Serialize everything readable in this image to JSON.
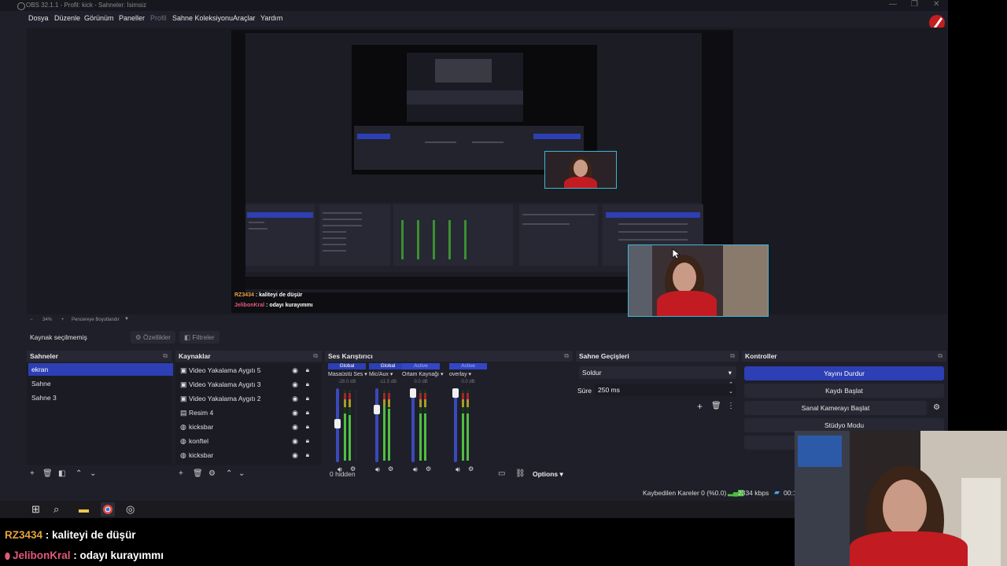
{
  "window": {
    "title": "OBS 32.1.1 - Profil: kick - Sahneler: İsimsiz",
    "controls": [
      "—",
      "❐",
      "✕"
    ]
  },
  "menu": [
    {
      "label": "Dosya",
      "enabled": true
    },
    {
      "label": "Düzenle",
      "enabled": true
    },
    {
      "label": "Görünüm",
      "enabled": true
    },
    {
      "label": "Paneller",
      "enabled": true
    },
    {
      "label": "Profil",
      "enabled": false
    },
    {
      "label": "Sahne Koleksiyonu",
      "enabled": true
    },
    {
      "label": "Araçlar",
      "enabled": true
    },
    {
      "label": "Yardım",
      "enabled": true
    }
  ],
  "preview": {
    "nested_chat": [
      {
        "name": "RZ3434",
        "message": " : kaliteyi de düşür"
      },
      {
        "name": "JelibonKral",
        "message": " : odayı kurayımmı"
      }
    ]
  },
  "zoom": {
    "value": "34%",
    "action": "Pencereye Boyutlandır"
  },
  "source_bar": {
    "status": "Kaynak seçilmemiş",
    "properties": "Özellikler",
    "filters": "Filtreler"
  },
  "scenes": {
    "title": "Sahneler",
    "items": [
      "ekran",
      "Sahne",
      "Sahne 3"
    ],
    "selected_index": 0
  },
  "sources": {
    "title": "Kaynaklar",
    "items": [
      {
        "label": "Video Yakalama Aygıtı 5",
        "icon": "camera-icon"
      },
      {
        "label": "Video Yakalama Aygıtı 3",
        "icon": "camera-icon"
      },
      {
        "label": "Video Yakalama Aygıtı 2",
        "icon": "camera-icon"
      },
      {
        "label": "Resim 4",
        "icon": "image-icon"
      },
      {
        "label": "kicksbar",
        "icon": "globe-icon"
      },
      {
        "label": "konftel",
        "icon": "globe-icon"
      },
      {
        "label": "kicksbar",
        "icon": "globe-icon"
      }
    ]
  },
  "mixer": {
    "title": "Ses Karıştırıcı",
    "channels": [
      {
        "tag": "Global",
        "tag_color": "#2d3fb4",
        "name": "Masaüstü Ses",
        "db": "-28.0 dB",
        "fader_level": 0.52
      },
      {
        "tag": "Global",
        "tag_color": "#2d3fb4",
        "name": "Mic/Aux",
        "db": "-11.5 dB",
        "fader_level": 0.75
      },
      {
        "tag": "Active",
        "tag_color": "#5a6ee0",
        "name": "Ortam Kaynağı",
        "db": "0.0 dB",
        "fader_level": 1.0
      },
      {
        "tag": "Active",
        "tag_color": "#5a6ee0",
        "name": "overlay",
        "db": "0.0 dB",
        "fader_level": 1.0
      }
    ],
    "hidden": "0 hidden",
    "options": "Options"
  },
  "transitions": {
    "title": "Sahne Geçişleri",
    "selected": "Soldur",
    "duration_label": "Süre",
    "duration_value": "250 ms"
  },
  "controls": {
    "title": "Kontroller",
    "buttons": [
      {
        "label": "Yayını Durdur",
        "primary": true
      },
      {
        "label": "Kaydı Başlat",
        "primary": false
      },
      {
        "label": "Sanal Kamerayı Başlat",
        "primary": false
      },
      {
        "label": "Stüdyo Modu",
        "primary": false
      }
    ]
  },
  "status": {
    "dropped": "Kaybedilen Kareler 0 (%0.0)",
    "bitrate": "2334 kbps",
    "timer": "00:1"
  },
  "chat": [
    {
      "name": "RZ3434",
      "message": " : kaliteyi de düşür",
      "name_color": "#e8a33c"
    },
    {
      "name": "JelibonKral",
      "message": " : odayı kurayımmı",
      "name_color": "#e05a7a"
    }
  ]
}
